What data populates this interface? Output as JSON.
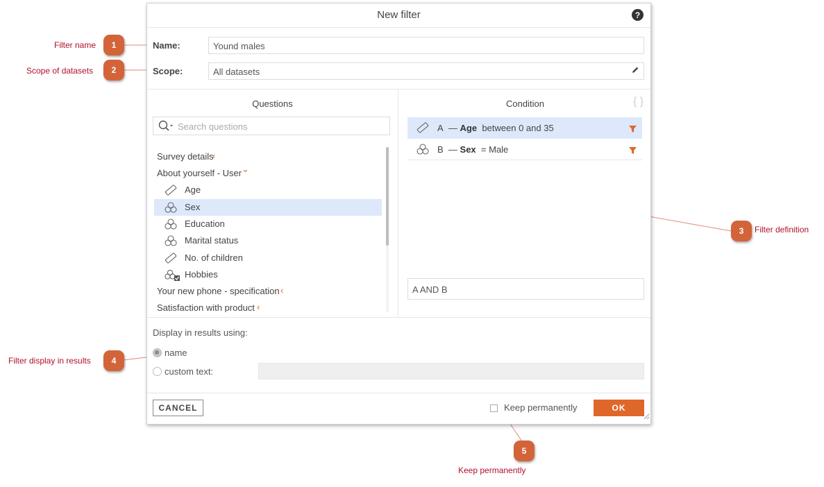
{
  "dialog": {
    "title": "New filter",
    "help_glyph": "?",
    "name_label": "Name:",
    "name_value": "Yound males",
    "scope_label": "Scope:",
    "scope_value": "All datasets"
  },
  "questions": {
    "header": "Questions",
    "search_placeholder": "Search questions",
    "items": [
      {
        "label": "Survey details",
        "type": "group",
        "arrow": "‹"
      },
      {
        "label": "About yourself - User",
        "type": "group",
        "arrow": "⌄"
      },
      {
        "label": "Age",
        "type": "question",
        "icon": "ruler-icon"
      },
      {
        "label": "Sex",
        "type": "question",
        "icon": "circles-icon",
        "selected": true
      },
      {
        "label": "Education",
        "type": "question",
        "icon": "circles-icon"
      },
      {
        "label": "Marital status",
        "type": "question",
        "icon": "circles-icon"
      },
      {
        "label": "No. of children",
        "type": "question",
        "icon": "ruler-icon"
      },
      {
        "label": "Hobbies",
        "type": "question",
        "icon": "circles-check-icon"
      },
      {
        "label": "Your new phone - specification",
        "type": "group",
        "arrow": "‹"
      },
      {
        "label": "Satisfaction with product",
        "type": "group",
        "arrow": "‹"
      }
    ]
  },
  "condition": {
    "header": "Condition",
    "braces": "{ }",
    "rows": [
      {
        "letter": "A",
        "dash": "—",
        "question": "Age",
        "condition": "between 0 and 35",
        "icon": "ruler-icon",
        "selected": true
      },
      {
        "letter": "B",
        "dash": "—",
        "question": "Sex",
        "condition": "= Male",
        "icon": "circles-icon",
        "selected": false
      }
    ],
    "expression": "A AND B"
  },
  "display": {
    "label": "Display in results using:",
    "option_name": "name",
    "option_custom": "custom text:",
    "selected": "name",
    "custom_value": ""
  },
  "footer": {
    "cancel_label": "CANCEL",
    "keep_label": "Keep permanently",
    "keep_checked": false,
    "ok_label": "OK"
  },
  "callouts": [
    {
      "number": "1",
      "label": "Filter name"
    },
    {
      "number": "2",
      "label": "Scope of datasets"
    },
    {
      "number": "3",
      "label": "Filter definition"
    },
    {
      "number": "4",
      "label": "Filter display in results"
    },
    {
      "number": "5",
      "label": "Keep permanently"
    }
  ],
  "colors": {
    "accent": "#e0672a",
    "selection": "#dde9fb",
    "callout_bubble": "#d3643a",
    "callout_text": "#b0102a"
  }
}
